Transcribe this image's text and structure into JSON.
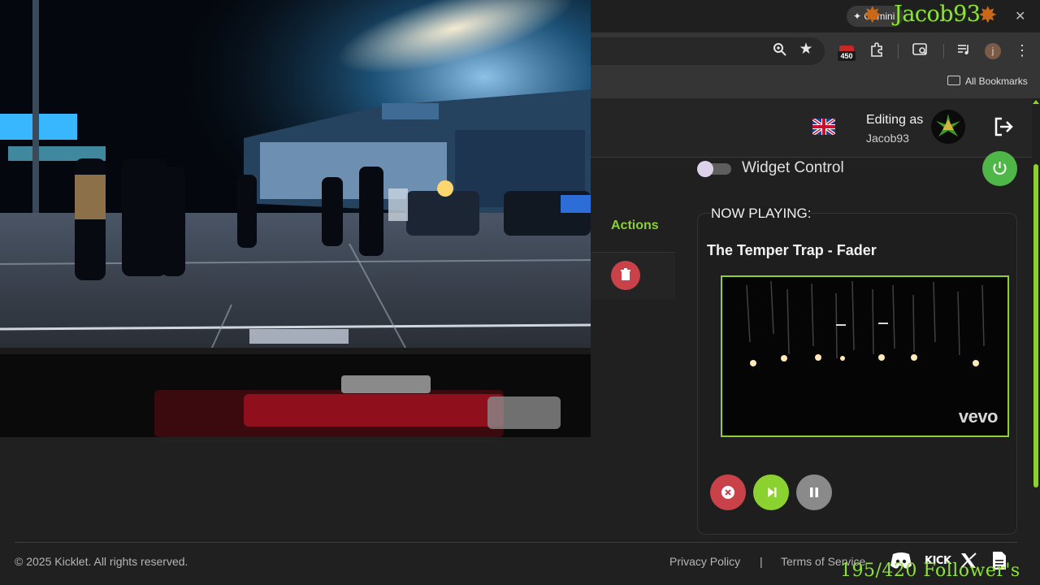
{
  "browser": {
    "gemini_label": "Gemini",
    "extension_badge": "450",
    "profile_initial": "j",
    "bookmarks_label": "All Bookmarks"
  },
  "overlay": {
    "username": "Jacob93",
    "followers": "195/420 Follower's"
  },
  "header": {
    "editing_label": "Editing as",
    "editing_user": "Jacob93"
  },
  "widget": {
    "toggle_label": "Widget Control"
  },
  "table": {
    "actions_header": "Actions"
  },
  "now_playing": {
    "label": "NOW PLAYING:",
    "title": "The Temper Trap - Fader",
    "watermark": "vevo"
  },
  "footer": {
    "copyright": "© 2025 Kicklet. All rights reserved.",
    "privacy": "Privacy Policy",
    "separator": "|",
    "terms": "Terms of Service",
    "kick_label": "KICK"
  },
  "colors": {
    "accent": "#8bd130",
    "danger": "#c9424a",
    "power": "#4fb648",
    "neutral_button": "#8a8a8a"
  }
}
